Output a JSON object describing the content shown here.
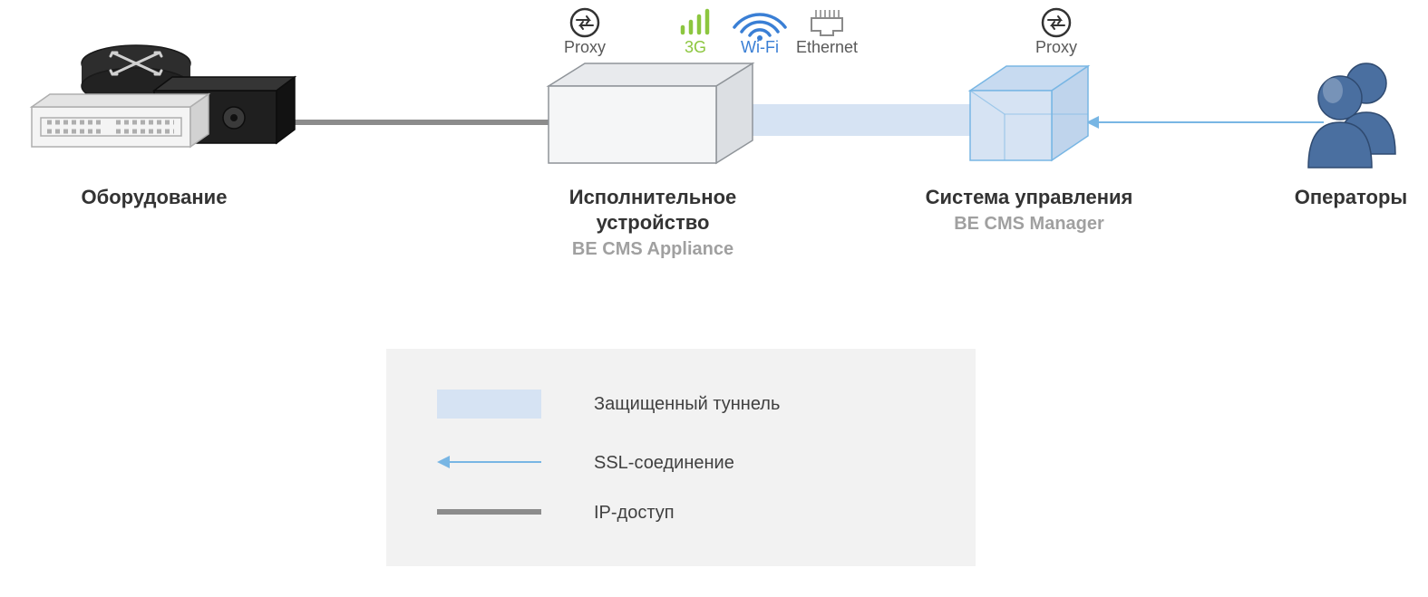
{
  "nodes": {
    "equipment": {
      "label": "Оборудование"
    },
    "appliance": {
      "label1": "Исполнительное",
      "label2": "устройство",
      "sub": "BE CMS Appliance"
    },
    "manager": {
      "label": "Система управления",
      "sub": "BE CMS Manager"
    },
    "operators": {
      "label": "Операторы"
    }
  },
  "icons": {
    "proxy_left": "Proxy",
    "threeg": "3G",
    "wifi": "Wi-Fi",
    "ethernet": "Ethernet",
    "proxy_right": "Proxy"
  },
  "legend": {
    "tunnel": "Защищенный туннель",
    "ssl": "SSL-соединение",
    "ip": "IP-доступ"
  },
  "colors": {
    "tunnel": "#d6e3f3",
    "ssl": "#78b6e4",
    "ip": "#8c8c8c",
    "box_face": "#f5f6f7",
    "box_top": "#e8eaed",
    "box_side": "#dcdfe3",
    "box_line": "#8f9499",
    "cube_face": "#d6e3f3",
    "cube_line": "#78b6e4",
    "people": "#4a6fa0",
    "green": "#8cc63f"
  }
}
